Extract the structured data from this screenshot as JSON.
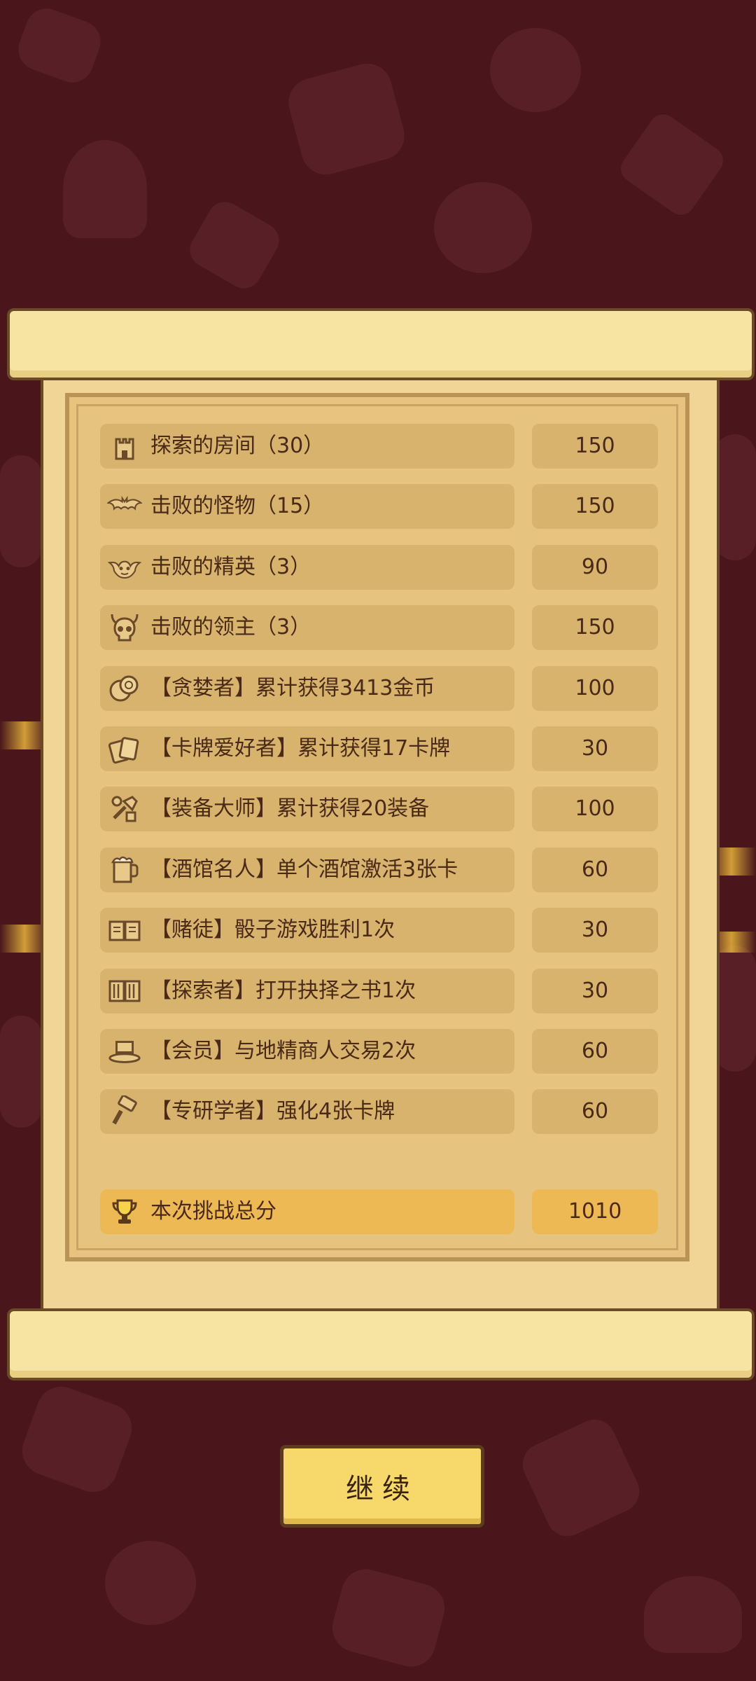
{
  "stats": [
    {
      "icon": "tower-icon",
      "label": "探索的房间（30）",
      "value": "150"
    },
    {
      "icon": "bat-icon",
      "label": "击败的怪物（15）",
      "value": "150"
    },
    {
      "icon": "elite-monster-icon",
      "label": "击败的精英（3）",
      "value": "90"
    },
    {
      "icon": "boss-skull-icon",
      "label": "击败的领主（3）",
      "value": "150"
    },
    {
      "icon": "coins-icon",
      "label": "【贪婪者】累计获得3413金币",
      "value": "100"
    },
    {
      "icon": "cards-icon",
      "label": "【卡牌爱好者】累计获得17卡牌",
      "value": "30"
    },
    {
      "icon": "equipment-icon",
      "label": "【装备大师】累计获得20装备",
      "value": "100"
    },
    {
      "icon": "beer-mug-icon",
      "label": "【酒馆名人】单个酒馆激活3张卡",
      "value": "60"
    },
    {
      "icon": "book-icon",
      "label": "【赌徒】骰子游戏胜利1次",
      "value": "30"
    },
    {
      "icon": "open-book-icon",
      "label": "【探索者】打开抉择之书1次",
      "value": "30"
    },
    {
      "icon": "top-hat-icon",
      "label": "【会员】与地精商人交易2次",
      "value": "60"
    },
    {
      "icon": "hammer-icon",
      "label": "【专研学者】强化4张卡牌",
      "value": "60"
    }
  ],
  "total": {
    "icon": "trophy-icon",
    "label": "本次挑战总分",
    "value": "1010"
  },
  "continue_label": "继续",
  "colors": {
    "background": "#4a161c",
    "paper": "#f1d596",
    "row": "#d7b36e",
    "total_row": "#edb955",
    "button": "#f6d96a"
  }
}
